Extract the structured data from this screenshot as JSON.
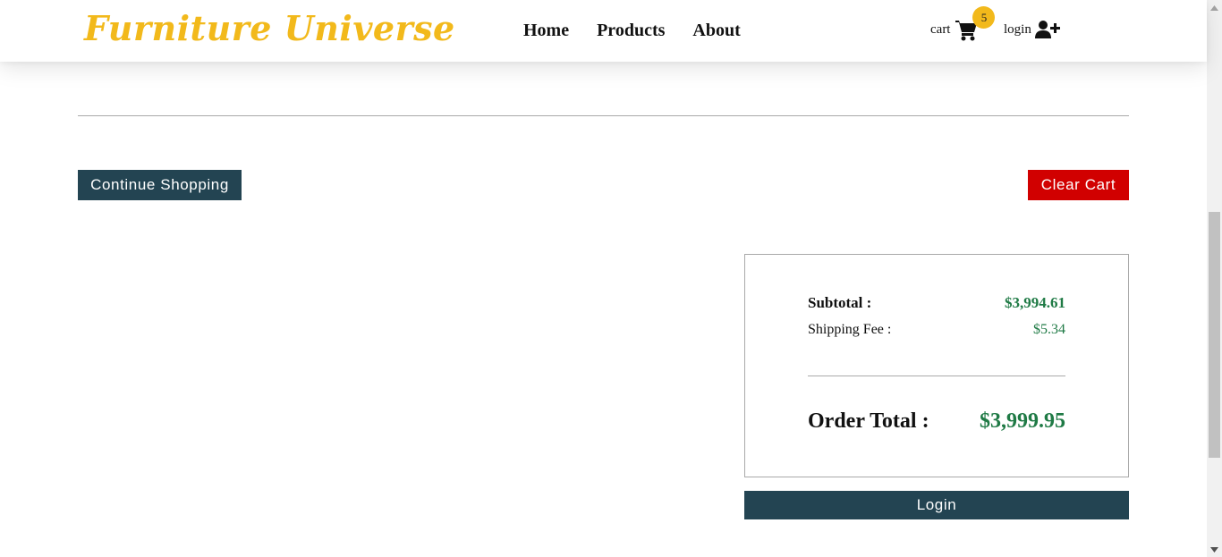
{
  "brand": {
    "logo_text": "Furniture Universe",
    "logo_color": "#f2b91b"
  },
  "nav": {
    "links": [
      {
        "label": "Home"
      },
      {
        "label": "Products"
      },
      {
        "label": "About"
      }
    ],
    "cart_label": "cart",
    "cart_icon": "shopping-cart-icon",
    "cart_count": "5",
    "login_label": "login",
    "login_icon": "user-plus-icon"
  },
  "actions": {
    "continue_label": "Continue Shopping",
    "clear_label": "Clear Cart"
  },
  "summary": {
    "subtotal_label": "Subtotal :",
    "subtotal_value": "$3,994.61",
    "shipping_label": "Shipping Fee :",
    "shipping_value": "$5.34",
    "total_label": "Order Total :",
    "total_value": "$3,999.95",
    "login_button_label": "Login"
  },
  "colors": {
    "primary_dark": "#234452",
    "danger": "#d10000",
    "price_green": "#1f7a45",
    "badge": "#f2b91b"
  }
}
